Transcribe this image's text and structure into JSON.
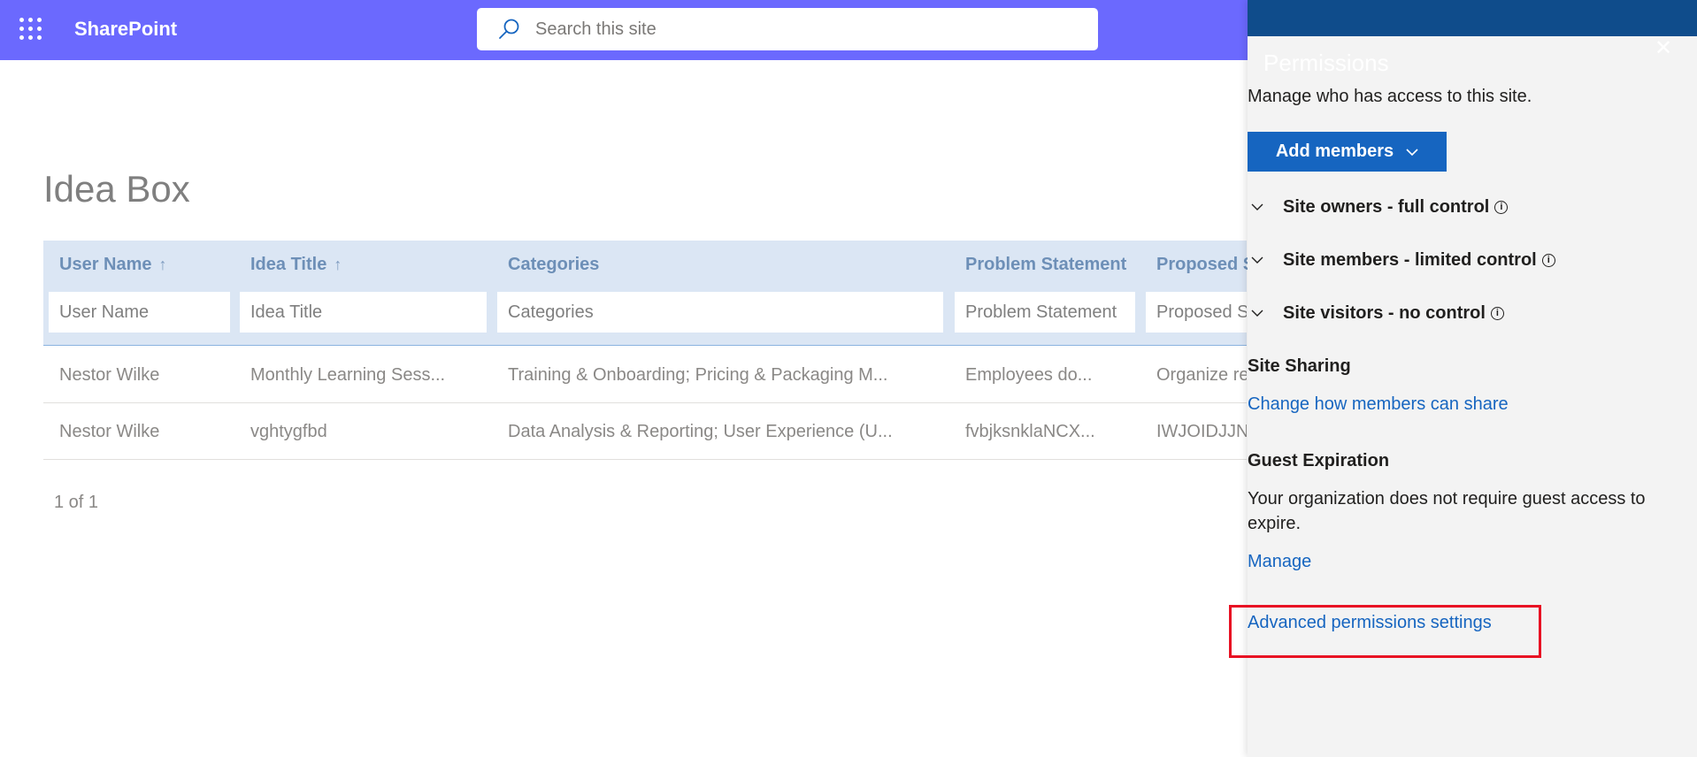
{
  "suitebar": {
    "brand": "SharePoint",
    "search_placeholder": "Search this site"
  },
  "page": {
    "title": "Idea Box"
  },
  "list": {
    "columns": [
      {
        "label": "User Name",
        "sort": "↑",
        "filter_placeholder": "User Name"
      },
      {
        "label": "Idea Title",
        "sort": "↑",
        "filter_placeholder": "Idea Title"
      },
      {
        "label": "Categories",
        "sort": "",
        "filter_placeholder": "Categories"
      },
      {
        "label": "Problem Statement",
        "sort": "",
        "filter_placeholder": "Problem Statement"
      },
      {
        "label": "Proposed S",
        "sort": "",
        "filter_placeholder": "Proposed S"
      }
    ],
    "rows": [
      [
        "Nestor Wilke",
        "Monthly Learning Sess...",
        "Training & Onboarding; Pricing & Packaging M...",
        "Employees do...",
        "Organize re"
      ],
      [
        "Nestor Wilke",
        "vghtygfbd",
        "Data Analysis & Reporting; User Experience (U...",
        "fvbjksnklaNCX...",
        "IWJOIDJJNC"
      ]
    ],
    "pager": "1 of 1"
  },
  "panel": {
    "title": "Permissions",
    "description": "Manage who has access to this site.",
    "add_members": "Add members",
    "groups": [
      "Site owners - full control",
      "Site members - limited control",
      "Site visitors - no control"
    ],
    "site_sharing_heading": "Site Sharing",
    "site_sharing_link": "Change how members can share",
    "guest_heading": "Guest Expiration",
    "guest_text": "Your organization does not require guest access to expire.",
    "manage_link": "Manage",
    "advanced_link": "Advanced permissions settings"
  },
  "colors": {
    "suitebar": "#6b69fe",
    "panel_header": "#0f4c8b",
    "accent": "#1665c0",
    "highlight": "#e81123"
  }
}
